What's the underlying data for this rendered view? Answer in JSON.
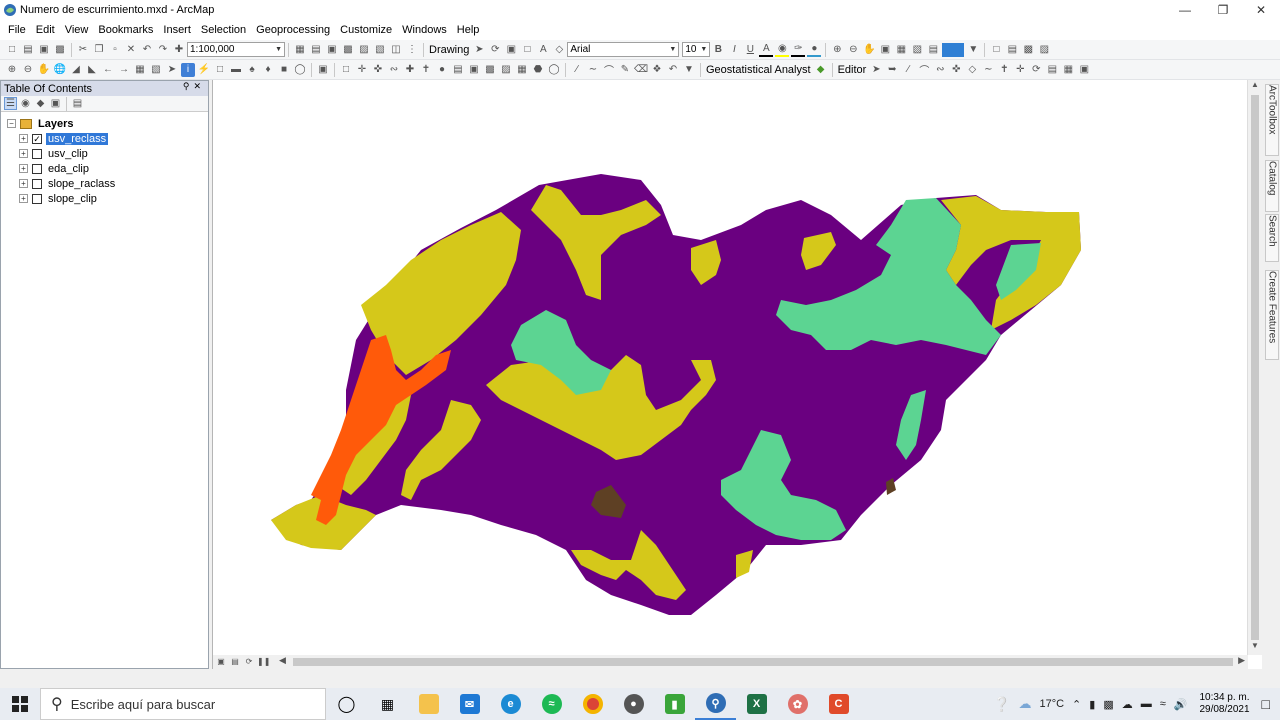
{
  "window": {
    "title": "Numero de escurrimiento.mxd - ArcMap"
  },
  "menu": [
    "File",
    "Edit",
    "View",
    "Bookmarks",
    "Insert",
    "Selection",
    "Geoprocessing",
    "Customize",
    "Windows",
    "Help"
  ],
  "toolbar": {
    "scale": "1:100,000",
    "drawing_label": "Drawing",
    "font_name": "Arial",
    "font_size": "10",
    "bold": "B",
    "italic": "I",
    "underline": "U",
    "text_tool": "A",
    "geostat_label": "Geostatistical Analyst",
    "editor_label": "Editor"
  },
  "toc": {
    "title": "Table Of Contents",
    "group_label": "Layers",
    "layers": [
      {
        "name": "usv_reclass",
        "checked": true,
        "selected": true
      },
      {
        "name": "usv_clip",
        "checked": false,
        "selected": false
      },
      {
        "name": "eda_clip",
        "checked": false,
        "selected": false
      },
      {
        "name": "slope_raclass",
        "checked": false,
        "selected": false
      },
      {
        "name": "slope_clip",
        "checked": false,
        "selected": false
      }
    ]
  },
  "right_tabs": [
    "ArcToolbox",
    "Catalog",
    "Search",
    "Create Features"
  ],
  "map_colors": {
    "purple": "#6a0080",
    "yellow": "#d5c81a",
    "green": "#5cd492",
    "orange": "#ff5a0a",
    "brown": "#5e4024"
  },
  "taskbar": {
    "search_placeholder": "Escribe aquí para buscar",
    "temperature": "17°C",
    "time": "10:34 p. m.",
    "date": "29/08/2021"
  }
}
